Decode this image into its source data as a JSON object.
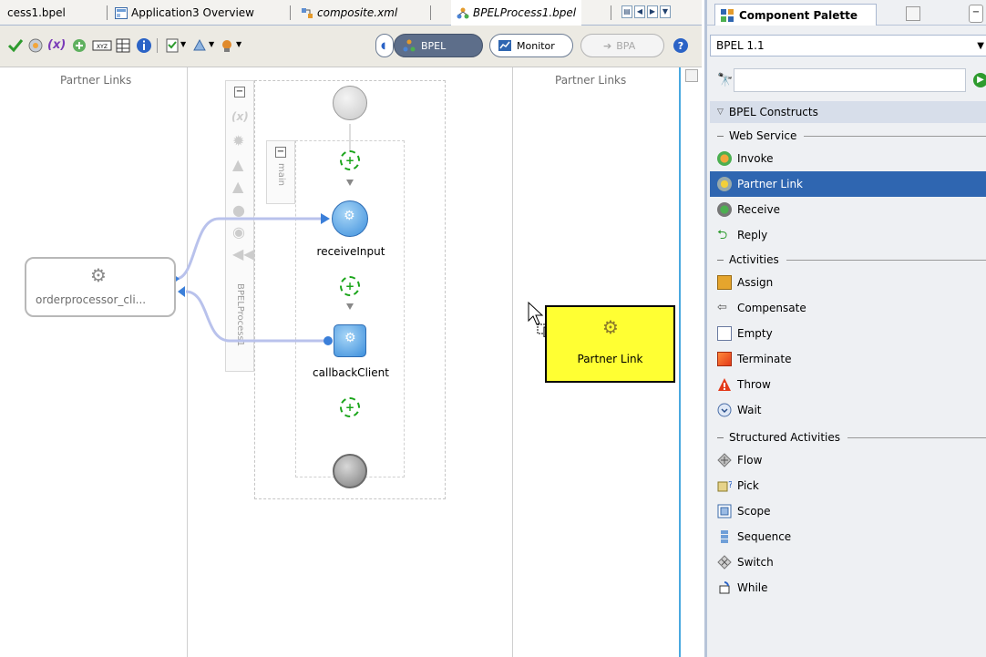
{
  "editor_tabs": [
    {
      "label": "cess1.bpel"
    },
    {
      "label": "Application3 Overview"
    },
    {
      "label": "composite.xml"
    },
    {
      "label": "BPELProcess1.bpel"
    }
  ],
  "toolbar": {
    "bpel_label": "BPEL",
    "monitor_label": "Monitor",
    "bpa_label": "BPA",
    "xpath_glyph": "(x)"
  },
  "canvas": {
    "left_partner_links_title": "Partner Links",
    "right_partner_links_title": "Partner Links",
    "process_label": "BPELProcess1",
    "scope_label": "main",
    "left_partner_link_name": "orderprocessor_cli...",
    "receive_activity_label": "receiveInput",
    "callback_activity_label": "callbackClient",
    "drag_preview_label": "Partner Link"
  },
  "palette": {
    "title": "Component Palette",
    "dropdown_value": "BPEL 1.1",
    "search_value": "",
    "section_title": "BPEL Constructs",
    "groups": [
      {
        "title": "Web Service",
        "items": [
          "Invoke",
          "Partner Link",
          "Receive",
          "Reply"
        ]
      },
      {
        "title": "Activities",
        "items": [
          "Assign",
          "Compensate",
          "Empty",
          "Terminate",
          "Throw",
          "Wait"
        ]
      },
      {
        "title": "Structured Activities",
        "items": [
          "Flow",
          "Pick",
          "Scope",
          "Sequence",
          "Switch",
          "While"
        ]
      }
    ],
    "selected_item": "Partner Link"
  },
  "colors": {
    "accent": "#2f66b1",
    "drag_preview_fill": "#ffff33",
    "connector": "#b9c2ec",
    "flow_add": "#1aa51a"
  }
}
